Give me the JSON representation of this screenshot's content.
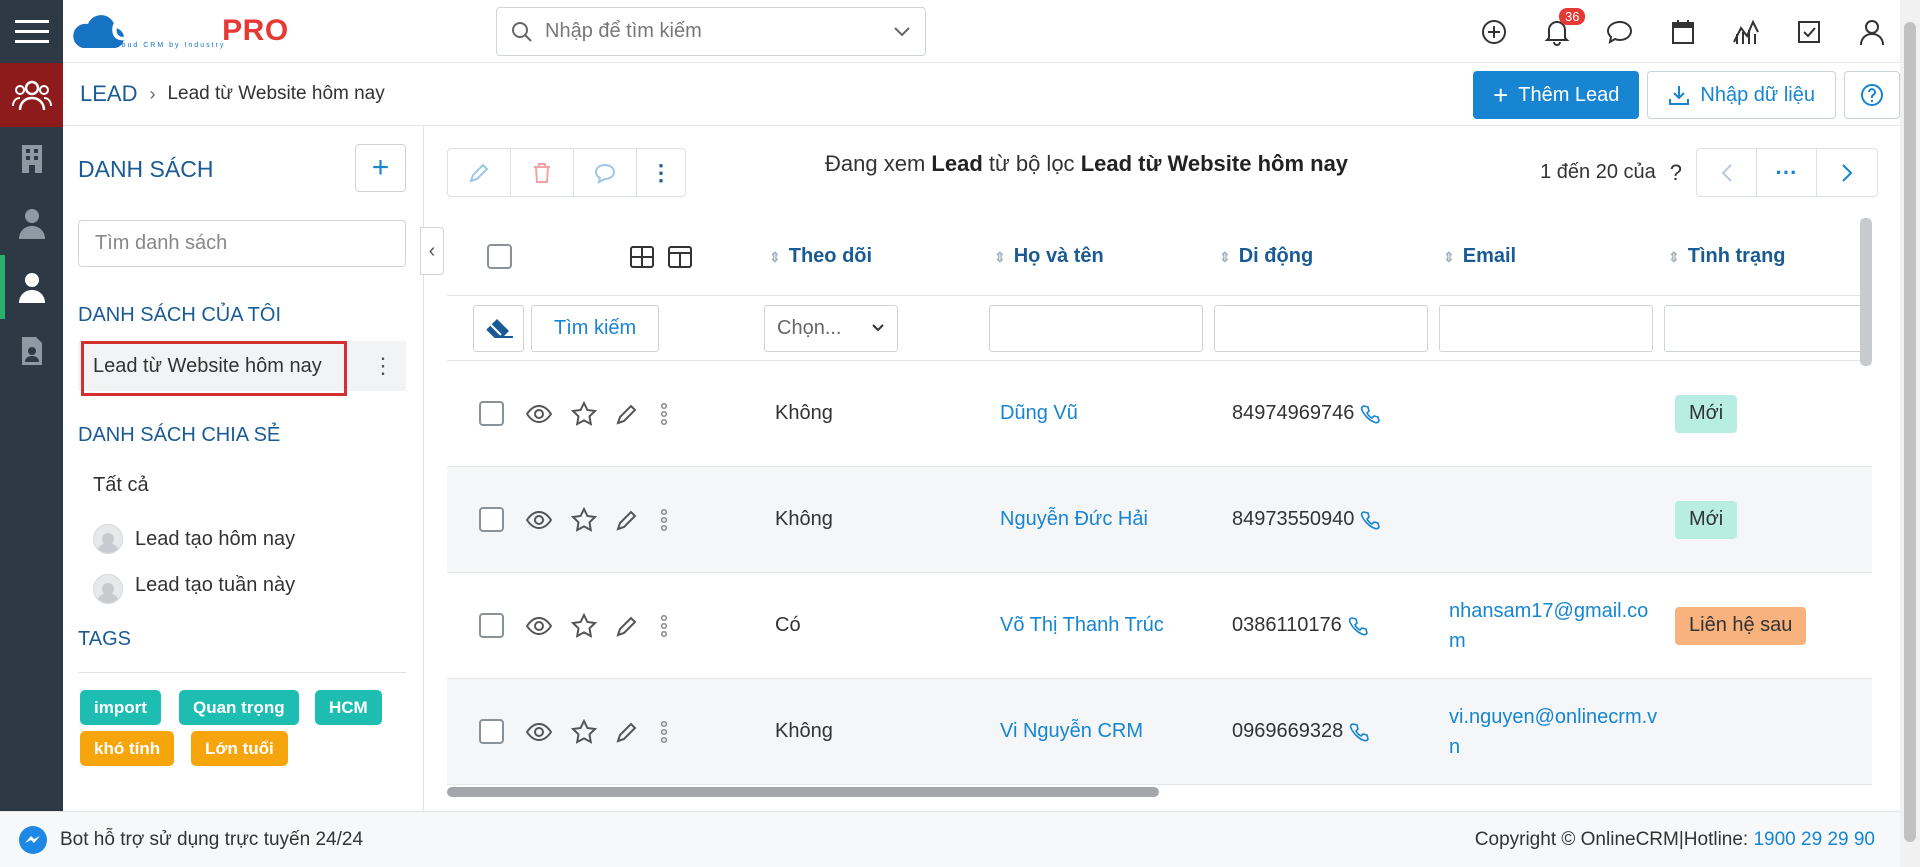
{
  "brand": {
    "logo_main": "CLOUD",
    "logo_accent": "PRO",
    "logo_sub": "Cloud CRM by Industry"
  },
  "search": {
    "placeholder": "Nhập để tìm kiếm"
  },
  "top_icons": {
    "notifications_count": "36"
  },
  "breadcrumb": {
    "root": "LEAD",
    "current": "Lead từ Website hôm nay"
  },
  "actions": {
    "add_lead": "Thêm Lead",
    "import": "Nhập dữ liệu"
  },
  "sidebar": {
    "title": "DANH SÁCH",
    "search_placeholder": "Tìm danh sách",
    "my_lists_title": "DANH SÁCH CỦA TÔI",
    "my_lists": [
      "Lead từ Website hôm nay"
    ],
    "shared_title": "DANH SÁCH CHIA SẺ",
    "shared": [
      "Tất cả",
      "Lead tạo hôm nay",
      "Lead tạo tuần này"
    ],
    "tags_title": "TAGS",
    "tags": [
      {
        "label": "import",
        "color": "#1dbeb1"
      },
      {
        "label": "Quan trọng",
        "color": "#1dbeb1"
      },
      {
        "label": "HCM",
        "color": "#1dbeb1"
      },
      {
        "label": "khó tính",
        "color": "#f7a50c"
      },
      {
        "label": "Lớn tuổi",
        "color": "#f7a50c"
      }
    ]
  },
  "viewing": {
    "prefix": "Đang xem",
    "module": "Lead",
    "middle": "từ bộ lọc",
    "filter": "Lead từ Website hôm nay"
  },
  "pager": {
    "range": "1 đến 20 của",
    "total": "?"
  },
  "table": {
    "headers": {
      "follow": "Theo dõi",
      "name": "Họ và tên",
      "mobile": "Di động",
      "email": "Email",
      "status": "Tình trạng"
    },
    "filter": {
      "search_btn": "Tìm kiếm",
      "select_placeholder": "Chọn..."
    },
    "rows": [
      {
        "follow": "Không",
        "name": "Dũng Vũ",
        "mobile": "84974969746",
        "email": "",
        "status": "Mới"
      },
      {
        "follow": "Không",
        "name": "Nguyễn Đức Hải",
        "mobile": "84973550940",
        "email": "",
        "status": "Mới"
      },
      {
        "follow": "Có",
        "name": "Võ Thị Thanh Trúc",
        "mobile": "0386110176",
        "email": "nhansam17@gmail.com",
        "status": "Liên hệ sau"
      },
      {
        "follow": "Không",
        "name": "Vi Nguyễn CRM",
        "mobile": "0969669328",
        "email": "vi.nguyen@onlinecrm.vn",
        "status": ""
      }
    ]
  },
  "footer": {
    "bot_text": "Bot hỗ trợ sử dụng trực tuyến 24/24",
    "copyright": "Copyright © OnlineCRM|Hotline:",
    "hotline": "1900 29 29 90"
  },
  "colors": {
    "primary": "#1785d1",
    "heading": "#1a5b96",
    "rail": "#2d3945",
    "rail_active": "#8e1b1b",
    "status_new": "#b7ede2",
    "status_later": "#f7b27d"
  }
}
